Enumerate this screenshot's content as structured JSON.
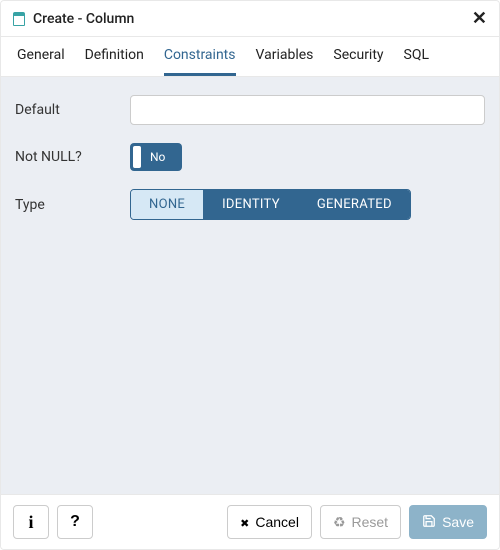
{
  "dialog": {
    "title": "Create - Column"
  },
  "tabs": {
    "items": [
      {
        "label": "General"
      },
      {
        "label": "Definition"
      },
      {
        "label": "Constraints"
      },
      {
        "label": "Variables"
      },
      {
        "label": "Security"
      },
      {
        "label": "SQL"
      }
    ],
    "active_index": 2
  },
  "fields": {
    "default": {
      "label": "Default",
      "value": ""
    },
    "not_null": {
      "label": "Not NULL?",
      "state_label": "No"
    },
    "type": {
      "label": "Type",
      "options": [
        {
          "label": "NONE"
        },
        {
          "label": "IDENTITY"
        },
        {
          "label": "GENERATED"
        }
      ],
      "selected_index": 0
    }
  },
  "footer": {
    "cancel": "Cancel",
    "reset": "Reset",
    "save": "Save"
  }
}
